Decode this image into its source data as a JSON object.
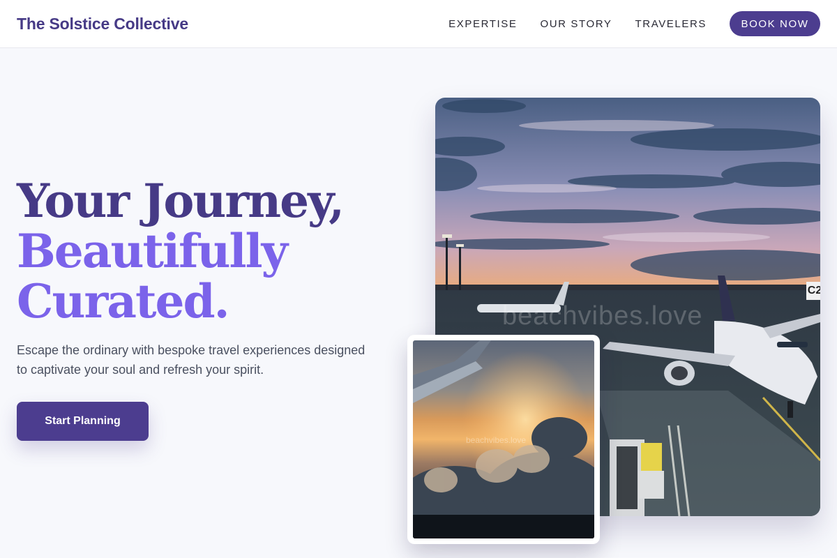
{
  "nav": {
    "brand": "The Solstice Collective",
    "links": [
      "EXPERTISE",
      "OUR STORY",
      "TRAVELERS"
    ],
    "book_label": "BOOK NOW"
  },
  "hero": {
    "title_line1": "Your Journey,",
    "title_line2": "Beautifully",
    "title_line3": "Curated.",
    "description": "Escape the ordinary with bespoke travel experiences designed to captivate your soul and refresh your spirit.",
    "cta_label": "Start Planning"
  },
  "images": {
    "main_watermark": "beachvibes.love",
    "gate_sign": "C2",
    "inset_watermark": "beachvibes.love"
  },
  "colors": {
    "brand_primary": "#463a86",
    "accent": "#7b63ea",
    "button": "#4c3d8f",
    "background": "#f7f8fc"
  }
}
